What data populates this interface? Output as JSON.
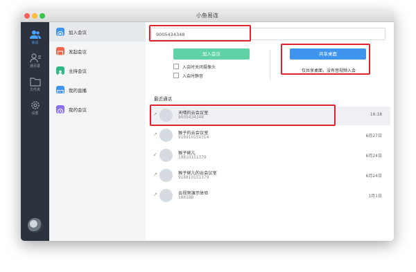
{
  "window": {
    "title": "小鱼易连"
  },
  "rail": [
    {
      "name": "rail-meeting",
      "label": "会议",
      "icon": "people-icon",
      "active": true
    },
    {
      "name": "rail-contacts",
      "label": "通讯录",
      "icon": "contacts-icon",
      "active": false
    },
    {
      "name": "rail-files",
      "label": "文件夹",
      "icon": "folder-icon",
      "active": false
    },
    {
      "name": "rail-settings",
      "label": "设置",
      "icon": "gear-icon",
      "active": false
    }
  ],
  "sidebar": {
    "items": [
      {
        "label": "加入会议",
        "color": "#3f94ee",
        "icon": "plus-icon",
        "active": true
      },
      {
        "label": "发起会议",
        "color": "#f0644a",
        "icon": "start-meeting-icon",
        "active": false
      },
      {
        "label": "主持会议",
        "color": "#2fb884",
        "icon": "host-icon",
        "active": false
      },
      {
        "label": "我的直播",
        "color": "#3f94ee",
        "icon": "live-icon",
        "active": false
      },
      {
        "label": "我的会议",
        "color": "#8a6ff0",
        "icon": "clock-icon",
        "active": false
      }
    ]
  },
  "main": {
    "search_value": "9005434348",
    "join_button": "加入会议",
    "options": [
      "入会时关闭摄像头",
      "入会时静音"
    ],
    "share_button": "共享桌面",
    "share_note": "仅共享桌面，没有音视频入会",
    "recent_title": "最近通话"
  },
  "calls": [
    {
      "name": "天晴的云会议室",
      "number": "9005434348",
      "time": "16:18",
      "direction": "outgoing"
    },
    {
      "name": "猴子的云会议室",
      "number": "918910151314",
      "time": "6月27日",
      "direction": "outgoing"
    },
    {
      "name": "猴子碗儿",
      "number": "18810151379",
      "time": "6月24日",
      "direction": "incoming"
    },
    {
      "name": "猴子碗儿的云会议室",
      "number": "918810151379",
      "time": "6月24日",
      "direction": "outgoing"
    },
    {
      "name": "云视频演示体验",
      "number": "188188",
      "time": "1月1日",
      "direction": "outgoing"
    }
  ],
  "colors": {
    "highlight": "#e0222d",
    "join": "#5fd3a6",
    "share": "#3f94ee",
    "rail_bg": "#2d333e"
  }
}
